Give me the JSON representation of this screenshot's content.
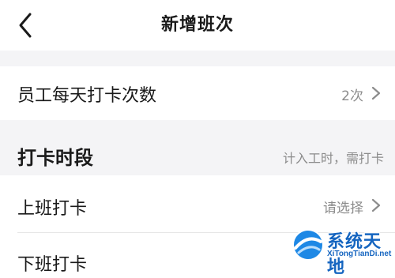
{
  "header": {
    "title": "新增班次",
    "back_icon": "chevron-left-icon"
  },
  "rows": {
    "daily_punch": {
      "label": "员工每天打卡次数",
      "value": "2次",
      "icon": "chevron-right-icon"
    },
    "clock_in": {
      "label": "上班打卡",
      "value": "请选择",
      "icon": "chevron-right-icon"
    },
    "clock_out": {
      "label": "下班打卡"
    }
  },
  "section": {
    "title": "打卡时段",
    "note": "计入工时，需打卡"
  },
  "watermark": {
    "title": "系统天地",
    "url": "XiTongTianDi.net"
  },
  "colors": {
    "background": "#ffffff",
    "section_background": "#f4f4f6",
    "secondary_text": "#8c8c8c",
    "watermark_blue": "#1565c0"
  }
}
